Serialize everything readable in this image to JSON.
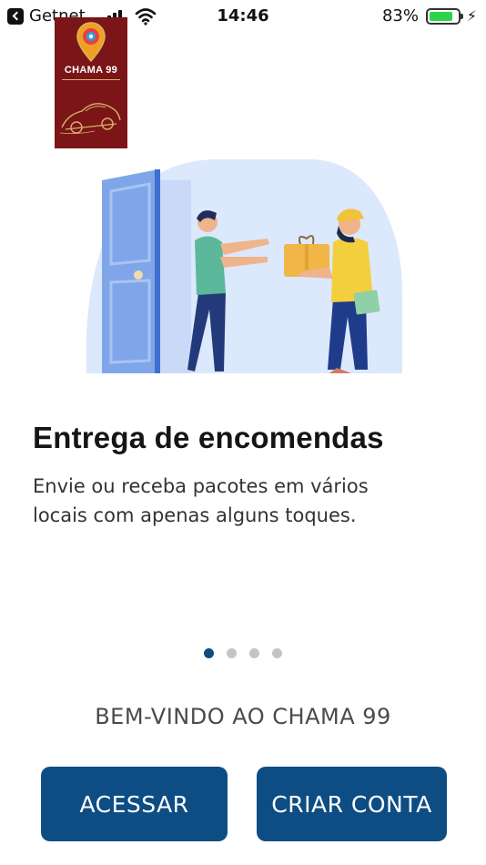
{
  "status_bar": {
    "carrier": "Getnet",
    "time": "14:46",
    "battery_percent": "83%",
    "battery_level": 0.83,
    "charging": true
  },
  "logo": {
    "text": "CHAMA 99",
    "background_color": "#7b1518",
    "accent_color": "#d8b36a"
  },
  "illustration": {
    "description_icon": "delivery-illustration",
    "circle_color": "#dce8fb",
    "door_color": "#7fa6e8"
  },
  "onboarding": {
    "title": "Entrega de encomendas",
    "description_line1": "Envie ou receba pacotes em vários",
    "description_line2": "locais com apenas alguns toques."
  },
  "pager": {
    "total": 4,
    "current": 1,
    "active_color": "#0e4d83",
    "inactive_color": "#c4c4c4"
  },
  "welcome_text": "BEM-VINDO AO CHAMA 99",
  "buttons": {
    "login_label": "ACESSAR",
    "signup_label": "CRIAR CONTA",
    "color": "#0e4d83"
  }
}
